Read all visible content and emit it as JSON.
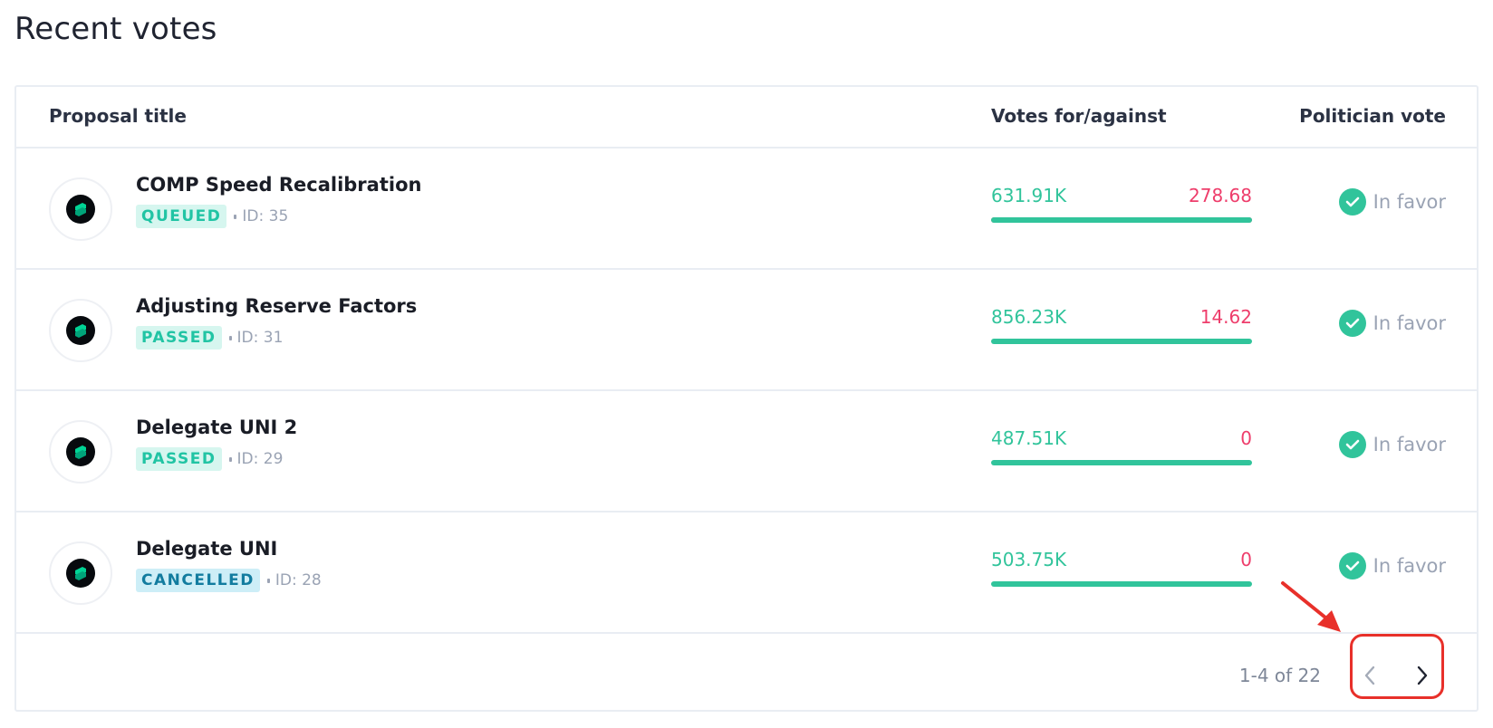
{
  "page": {
    "title": "Recent votes"
  },
  "table": {
    "headers": {
      "title": "Proposal title",
      "votes": "Votes for/against",
      "politician": "Politician vote"
    },
    "rows": [
      {
        "title": "COMP Speed Recalibration",
        "status": "QUEUED",
        "id": "ID: 35",
        "votes_for": "631.91K",
        "votes_against": "278.68",
        "for_fraction": 0.9996,
        "politician_vote": "In favor"
      },
      {
        "title": "Adjusting Reserve Factors",
        "status": "PASSED",
        "id": "ID: 31",
        "votes_for": "856.23K",
        "votes_against": "14.62",
        "for_fraction": 1.0,
        "politician_vote": "In favor"
      },
      {
        "title": "Delegate UNI 2",
        "status": "PASSED",
        "id": "ID: 29",
        "votes_for": "487.51K",
        "votes_against": "0",
        "for_fraction": 1.0,
        "politician_vote": "In favor"
      },
      {
        "title": "Delegate UNI",
        "status": "CANCELLED",
        "id": "ID: 28",
        "votes_for": "503.75K",
        "votes_against": "0",
        "for_fraction": 1.0,
        "politician_vote": "In favor"
      }
    ]
  },
  "pagination": {
    "range": "1-4 of 22"
  },
  "icons": {
    "avatar": "compound-logo-icon",
    "vote": "check-circle-icon",
    "prev": "chevron-left-icon",
    "next": "chevron-right-icon"
  },
  "colors": {
    "for": "#31c49b",
    "against": "#ee3d6b",
    "accent_highlight": "#e8302a"
  }
}
